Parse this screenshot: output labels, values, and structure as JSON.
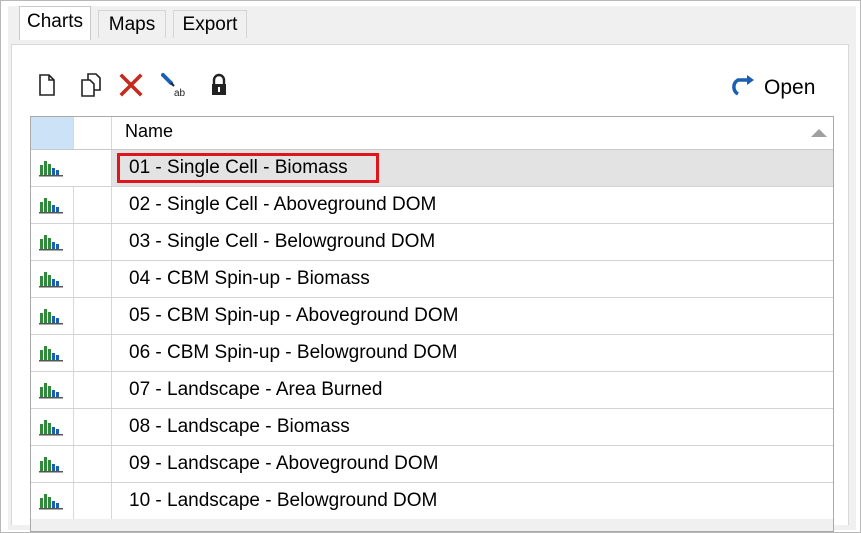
{
  "tabs": [
    {
      "label": "Charts",
      "active": true
    },
    {
      "label": "Maps",
      "active": false
    },
    {
      "label": "Export",
      "active": false
    }
  ],
  "toolbar": {
    "icons": [
      "new-document-icon",
      "copy-icon",
      "delete-icon",
      "rename-icon",
      "lock-icon"
    ],
    "open_label": "Open",
    "open_icon": "redo-arrow-icon"
  },
  "grid": {
    "column_header": "Name",
    "sort": "ascending",
    "rows": [
      {
        "name": "01 - Single Cell - Biomass",
        "selected": true
      },
      {
        "name": "02 - Single Cell - Aboveground DOM"
      },
      {
        "name": "03 - Single Cell - Belowground DOM"
      },
      {
        "name": "04 - CBM Spin-up - Biomass"
      },
      {
        "name": "05 - CBM Spin-up - Aboveground DOM"
      },
      {
        "name": "06 - CBM Spin-up - Belowground DOM"
      },
      {
        "name": "07 - Landscape - Area Burned"
      },
      {
        "name": "08 - Landscape - Biomass"
      },
      {
        "name": "09 - Landscape - Aboveground DOM"
      },
      {
        "name": "10 - Landscape - Belowground DOM"
      }
    ]
  },
  "colors": {
    "highlight": "#e0151b",
    "delete": "#c42b1c",
    "open_arrow": "#1a5fb4",
    "header_selection": "#cce3f7"
  }
}
